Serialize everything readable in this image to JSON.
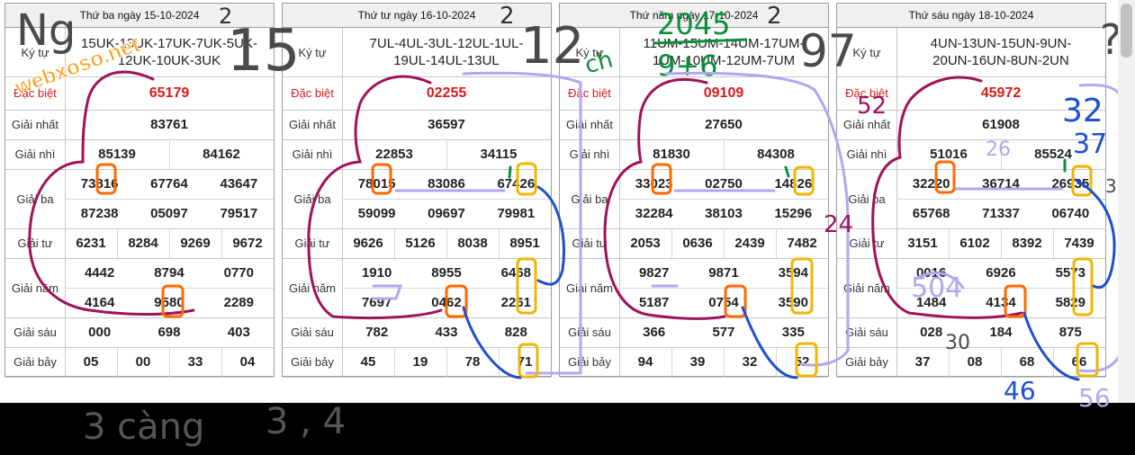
{
  "site": {
    "watermark": "webxoso.net"
  },
  "labels": {
    "ky_tu": "Ký tự",
    "dac_biet": "Đặc biệt",
    "giai_nhat": "Giải nhất",
    "giai_nhi": "Giải nhì",
    "giai_ba": "Giải ba",
    "giai_tu": "Giải tư",
    "giai_nam": "Giải năm",
    "giai_sau": "Giải sáu",
    "giai_bay": "Giải bảy"
  },
  "boards": [
    {
      "date": "Thứ ba ngày 15-10-2024",
      "ky_tu": "15UK-13UK-17UK-7UK-5UK-12UK-10UK-3UK",
      "dac_biet": "65179",
      "nhat": "83761",
      "nhi": [
        "85139",
        "84162"
      ],
      "ba": [
        "73816",
        "67764",
        "43647",
        "87238",
        "05097",
        "79517"
      ],
      "tu": [
        "6231",
        "8284",
        "9269",
        "9672"
      ],
      "nam": [
        "4442",
        "8794",
        "0770",
        "4164",
        "9580",
        "2289"
      ],
      "sau": [
        "000",
        "698",
        "403"
      ],
      "bay": [
        "05",
        "00",
        "33",
        "04"
      ]
    },
    {
      "date": "Thứ tư ngày 16-10-2024",
      "ky_tu": "7UL-4UL-3UL-12UL-1UL-19UL-14UL-13UL",
      "dac_biet": "02255",
      "nhat": "36597",
      "nhi": [
        "22853",
        "34115"
      ],
      "ba": [
        "78015",
        "83086",
        "67426",
        "59099",
        "09697",
        "79981"
      ],
      "tu": [
        "9626",
        "5126",
        "8038",
        "8951"
      ],
      "nam": [
        "1910",
        "8955",
        "6468",
        "7697",
        "0462",
        "2261"
      ],
      "sau": [
        "782",
        "433",
        "828"
      ],
      "bay": [
        "45",
        "19",
        "78",
        "71"
      ]
    },
    {
      "date": "Thứ năm ngày 17-10-2024",
      "ky_tu": "11UM-15UM-14UM-17UM-1UM-10UM-12UM-7UM",
      "dac_biet": "09109",
      "nhat": "27650",
      "nhi": [
        "81830",
        "84308"
      ],
      "ba": [
        "33023",
        "02750",
        "14826",
        "32284",
        "38103",
        "15296"
      ],
      "tu": [
        "2053",
        "0636",
        "2439",
        "7482"
      ],
      "nam": [
        "9827",
        "9871",
        "3594",
        "5187",
        "0754",
        "3590"
      ],
      "sau": [
        "366",
        "577",
        "335"
      ],
      "bay": [
        "94",
        "39",
        "32",
        "52"
      ]
    },
    {
      "date": "Thứ sáu ngày 18-10-2024",
      "ky_tu": "4UN-13UN-15UN-9UN-20UN-16UN-8UN-2UN",
      "dac_biet": "45972",
      "nhat": "61908",
      "nhi": [
        "51016",
        "85524"
      ],
      "ba": [
        "32220",
        "36714",
        "26935",
        "65768",
        "71337",
        "06740"
      ],
      "tu": [
        "3151",
        "6102",
        "8392",
        "7439"
      ],
      "nam": [
        "0016",
        "6926",
        "5573",
        "1484",
        "4134",
        "5829"
      ],
      "sau": [
        "028",
        "184",
        "875"
      ],
      "bay": [
        "37",
        "08",
        "68",
        "66"
      ]
    }
  ],
  "handwriting": {
    "top_digits": [
      "Ng",
      "2",
      "15",
      "2",
      "12",
      "2",
      "97",
      "?"
    ],
    "green_note": [
      "ch",
      "2045",
      "9+6"
    ],
    "side_numbers": [
      "52",
      "24",
      "32",
      "37",
      "26",
      "30",
      "504",
      "30",
      "46",
      "56"
    ],
    "bottom_text": [
      "3 càng",
      "3 , 4"
    ]
  },
  "colors": {
    "red": "#d81b1b",
    "maroon_ink": "#a0125a",
    "orange_ink": "#ff6a00",
    "yellow_ink": "#f5b400",
    "blue_ink": "#1f4fd1",
    "lavender_ink": "#b3a6f0",
    "green_ink": "#0c8f3c",
    "gray_ink": "#4a4a4a"
  }
}
